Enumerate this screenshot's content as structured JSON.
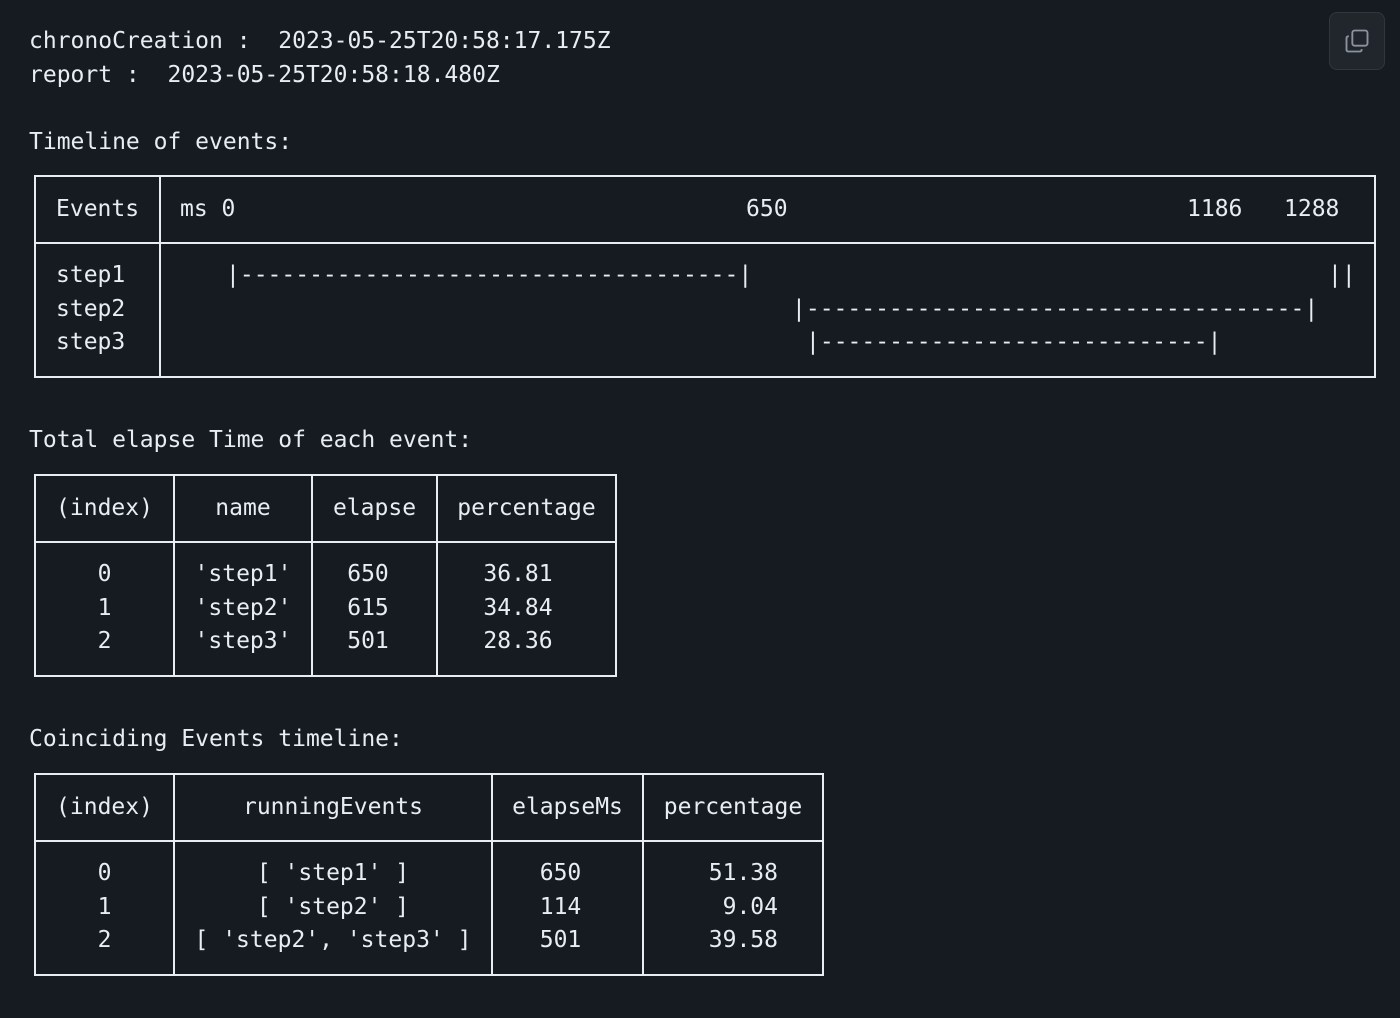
{
  "header": {
    "chrono_line": "chronoCreation :  2023-05-25T20:58:17.175Z",
    "report_line": "report :  2023-05-25T20:58:18.480Z"
  },
  "timeline": {
    "heading": "Timeline of events:",
    "col_events": "Events",
    "axis_label": "ms 0",
    "tick_650": "650",
    "tick_1186": "1186",
    "tick_1288": "1288",
    "rows": [
      {
        "name": "step1",
        "bar": "|------------------------------------|",
        "end_marker": "||"
      },
      {
        "name": "step2",
        "bar": "|------------------------------------|"
      },
      {
        "name": "step3",
        "bar": "|----------------------------|"
      }
    ]
  },
  "elapse_table": {
    "heading": "Total elapse Time of each event:",
    "headers": [
      "(index)",
      "name",
      "elapse",
      "percentage"
    ],
    "rows": [
      [
        "0",
        "'step1'",
        "650",
        "36.81"
      ],
      [
        "1",
        "'step2'",
        "615",
        "34.84"
      ],
      [
        "2",
        "'step3'",
        "501",
        "28.36"
      ]
    ]
  },
  "coinciding_table": {
    "heading": "Coinciding Events timeline:",
    "headers": [
      "(index)",
      "runningEvents",
      "elapseMs",
      "percentage"
    ],
    "rows": [
      [
        "0",
        "[ 'step1' ]",
        "650",
        "51.38"
      ],
      [
        "1",
        "[ 'step2' ]",
        "114",
        "9.04"
      ],
      [
        "2",
        "[ 'step2', 'step3' ]",
        "501",
        "39.58"
      ]
    ]
  },
  "toolbar": {
    "copy_icon": "copy-icon"
  }
}
